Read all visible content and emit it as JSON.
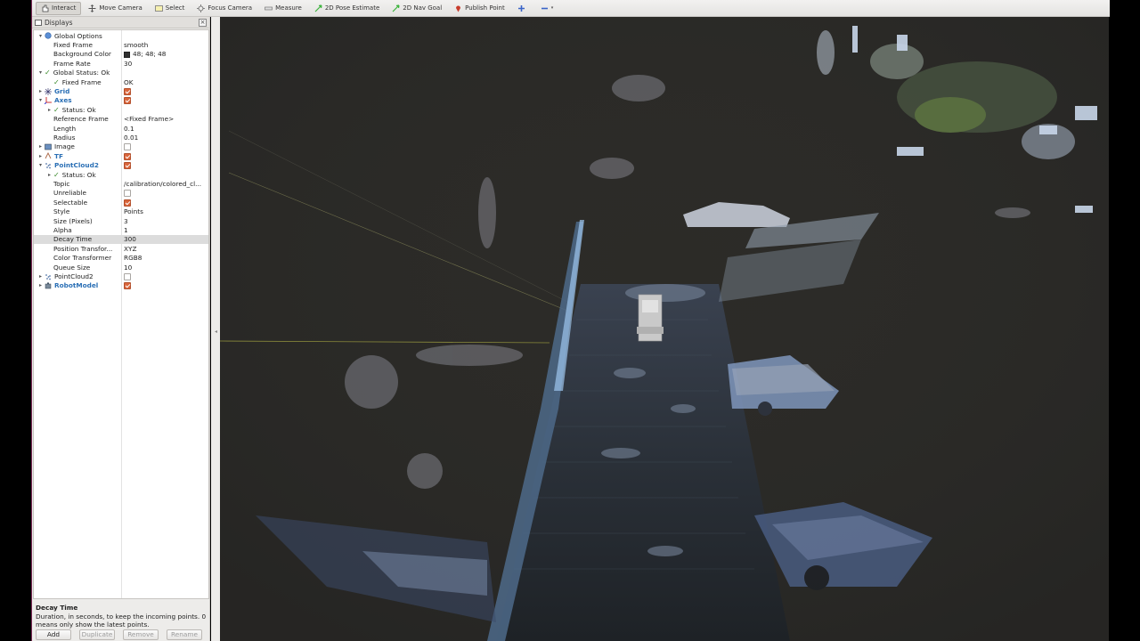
{
  "toolbar": {
    "items": [
      {
        "label": "Interact",
        "icon": "interact-icon",
        "active": true
      },
      {
        "label": "Move Camera",
        "icon": "move-camera-icon"
      },
      {
        "label": "Select",
        "icon": "select-icon"
      },
      {
        "label": "Focus Camera",
        "icon": "focus-camera-icon"
      },
      {
        "label": "Measure",
        "icon": "measure-icon"
      },
      {
        "label": "2D Pose Estimate",
        "icon": "pose-estimate-icon"
      },
      {
        "label": "2D Nav Goal",
        "icon": "nav-goal-icon"
      },
      {
        "label": "Publish Point",
        "icon": "publish-point-icon"
      }
    ]
  },
  "panel": {
    "title": "Displays",
    "close": "×"
  },
  "tree": [
    {
      "indent": 0,
      "arrow": "▾",
      "icon": "globe-icon",
      "name": "Global Options",
      "style": "normal",
      "value": ""
    },
    {
      "indent": 1,
      "name": "Fixed Frame",
      "value": "smooth"
    },
    {
      "indent": 1,
      "name": "Background Color",
      "value": "48; 48; 48",
      "swatch": "#303030"
    },
    {
      "indent": 1,
      "name": "Frame Rate",
      "value": "30"
    },
    {
      "indent": 0,
      "arrow": "▾",
      "check": true,
      "name": "Global Status: Ok",
      "style": "normal",
      "value": ""
    },
    {
      "indent": 1,
      "check": true,
      "name": "Fixed Frame",
      "value": "OK"
    },
    {
      "indent": 0,
      "arrow": "▸",
      "icon": "grid-icon",
      "name": "Grid",
      "style": "blue",
      "checkbox": true
    },
    {
      "indent": 0,
      "arrow": "▾",
      "icon": "axes-icon",
      "name": "Axes",
      "style": "blue",
      "checkbox": true
    },
    {
      "indent": 1,
      "arrow": "▸",
      "check": true,
      "name": "Status: Ok",
      "value": ""
    },
    {
      "indent": 1,
      "name": "Reference Frame",
      "value": "<Fixed Frame>"
    },
    {
      "indent": 1,
      "name": "Length",
      "value": "0.1"
    },
    {
      "indent": 1,
      "name": "Radius",
      "value": "0.01"
    },
    {
      "indent": 0,
      "arrow": "▸",
      "icon": "image-icon",
      "name": "Image",
      "style": "normal",
      "checkbox": false
    },
    {
      "indent": 0,
      "arrow": "▸",
      "icon": "tf-icon",
      "name": "TF",
      "style": "blue",
      "checkbox": true
    },
    {
      "indent": 0,
      "arrow": "▾",
      "icon": "pointcloud-icon",
      "name": "PointCloud2",
      "style": "blue",
      "checkbox": true
    },
    {
      "indent": 1,
      "arrow": "▸",
      "check": true,
      "name": "Status: Ok",
      "value": ""
    },
    {
      "indent": 1,
      "name": "Topic",
      "value": "/calibration/colored_cl..."
    },
    {
      "indent": 1,
      "name": "Unreliable",
      "checkbox": false
    },
    {
      "indent": 1,
      "name": "Selectable",
      "checkbox": true
    },
    {
      "indent": 1,
      "name": "Style",
      "value": "Points"
    },
    {
      "indent": 1,
      "name": "Size (Pixels)",
      "value": "3"
    },
    {
      "indent": 1,
      "name": "Alpha",
      "value": "1"
    },
    {
      "indent": 1,
      "name": "Decay Time",
      "value": "300",
      "selected": true
    },
    {
      "indent": 1,
      "name": "Position Transfor...",
      "value": "XYZ"
    },
    {
      "indent": 1,
      "name": "Color Transformer",
      "value": "RGB8"
    },
    {
      "indent": 1,
      "name": "Queue Size",
      "value": "10"
    },
    {
      "indent": 0,
      "arrow": "▸",
      "icon": "pointcloud-icon",
      "name": "PointCloud2",
      "style": "normal",
      "checkbox": false
    },
    {
      "indent": 0,
      "arrow": "▸",
      "icon": "robot-icon",
      "name": "RobotModel",
      "style": "blue",
      "checkbox": true
    }
  ],
  "description": {
    "title": "Decay Time",
    "text": "Duration, in seconds, to keep the incoming points. 0 means only show the latest points."
  },
  "buttons": [
    {
      "label": "Add",
      "enabled": true
    },
    {
      "label": "Duplicate",
      "enabled": false
    },
    {
      "label": "Remove",
      "enabled": false
    },
    {
      "label": "Rename",
      "enabled": false
    }
  ],
  "colors": {
    "background": "#303030",
    "checkbox_on": "#d9653b",
    "accent_blue": "#2a6fb5"
  }
}
